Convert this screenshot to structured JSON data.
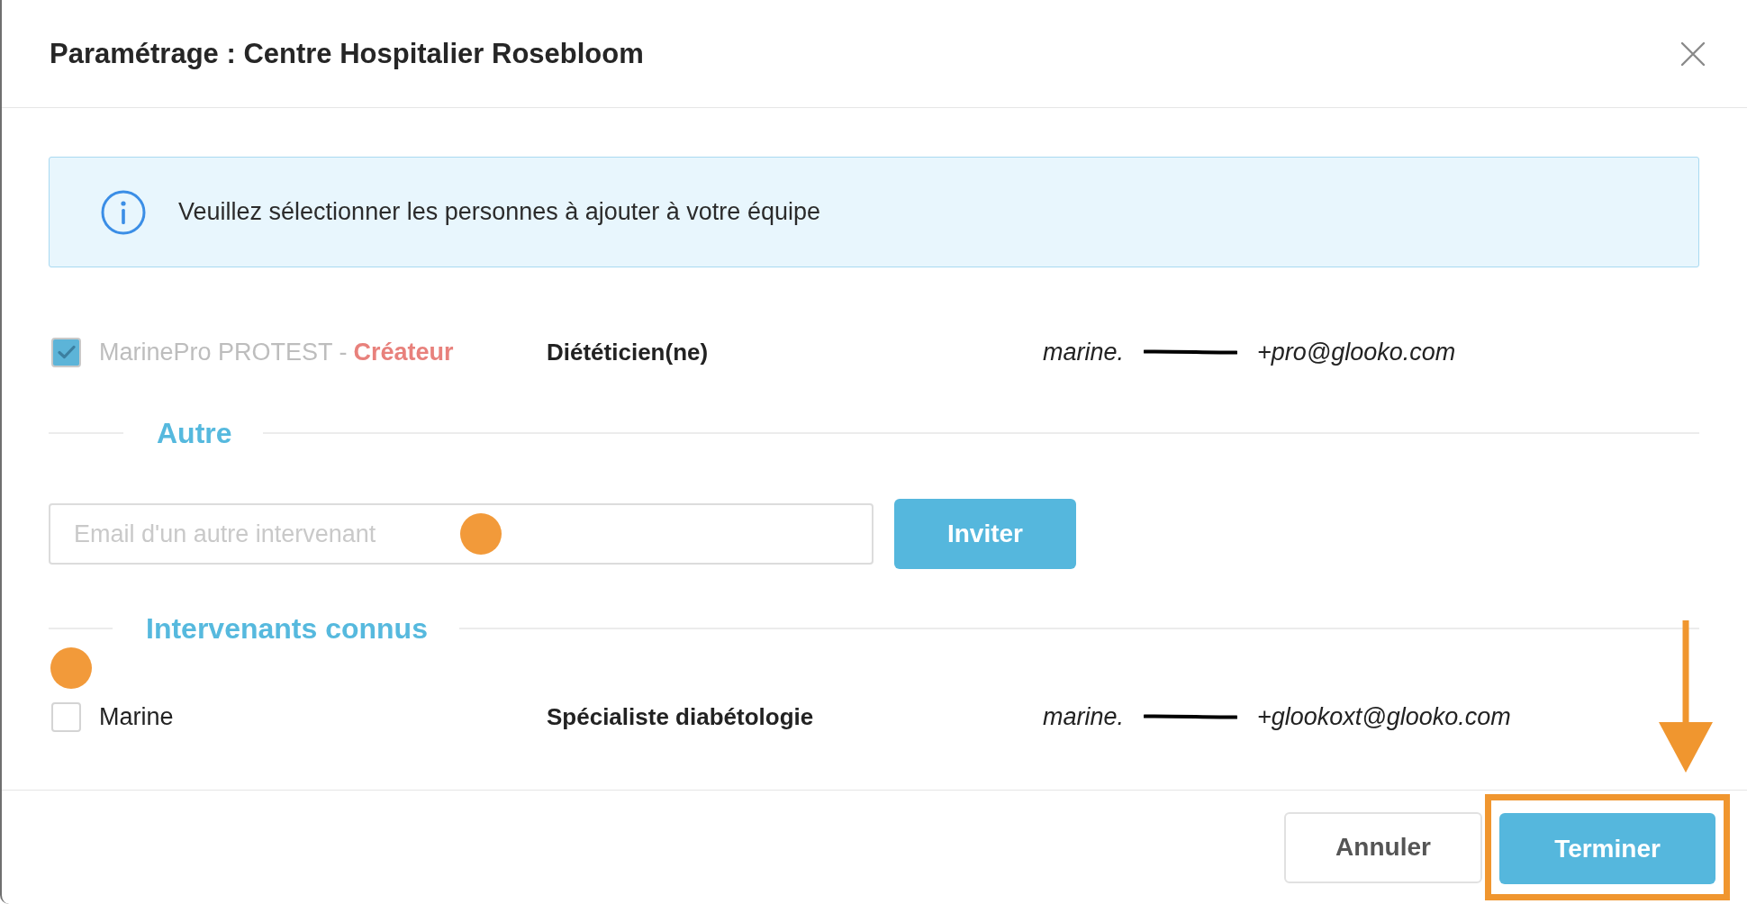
{
  "dialog": {
    "title": "Paramétrage : Centre Hospitalier Rosebloom"
  },
  "notice": {
    "text": "Veuillez sélectionner les personnes à ajouter à votre équipe"
  },
  "team_members": [
    {
      "name": "MarinePro PROTEST -",
      "tag": "Créateur",
      "role": "Diététicien(ne)",
      "email_start": "marine.",
      "email_end": "+pro@glooko.com",
      "checked": true,
      "disabled": true
    }
  ],
  "other_section": {
    "heading": "Autre",
    "email_field": {
      "placeholder": "Email d'un autre intervenant"
    },
    "invite_button": "Inviter"
  },
  "known_section": {
    "heading": "Intervenants connus",
    "members": [
      {
        "name": "Marine",
        "role": "Spécialiste diabétologie",
        "email_start": "marine.",
        "email_end": "+glookoxt@glooko.com",
        "checked": false,
        "disabled": false
      }
    ]
  },
  "buttons": [
    {
      "label": "Annuler",
      "kind": "secondary",
      "highlighted": false
    },
    {
      "label": "Terminer",
      "kind": "primary",
      "highlighted": true
    }
  ]
}
